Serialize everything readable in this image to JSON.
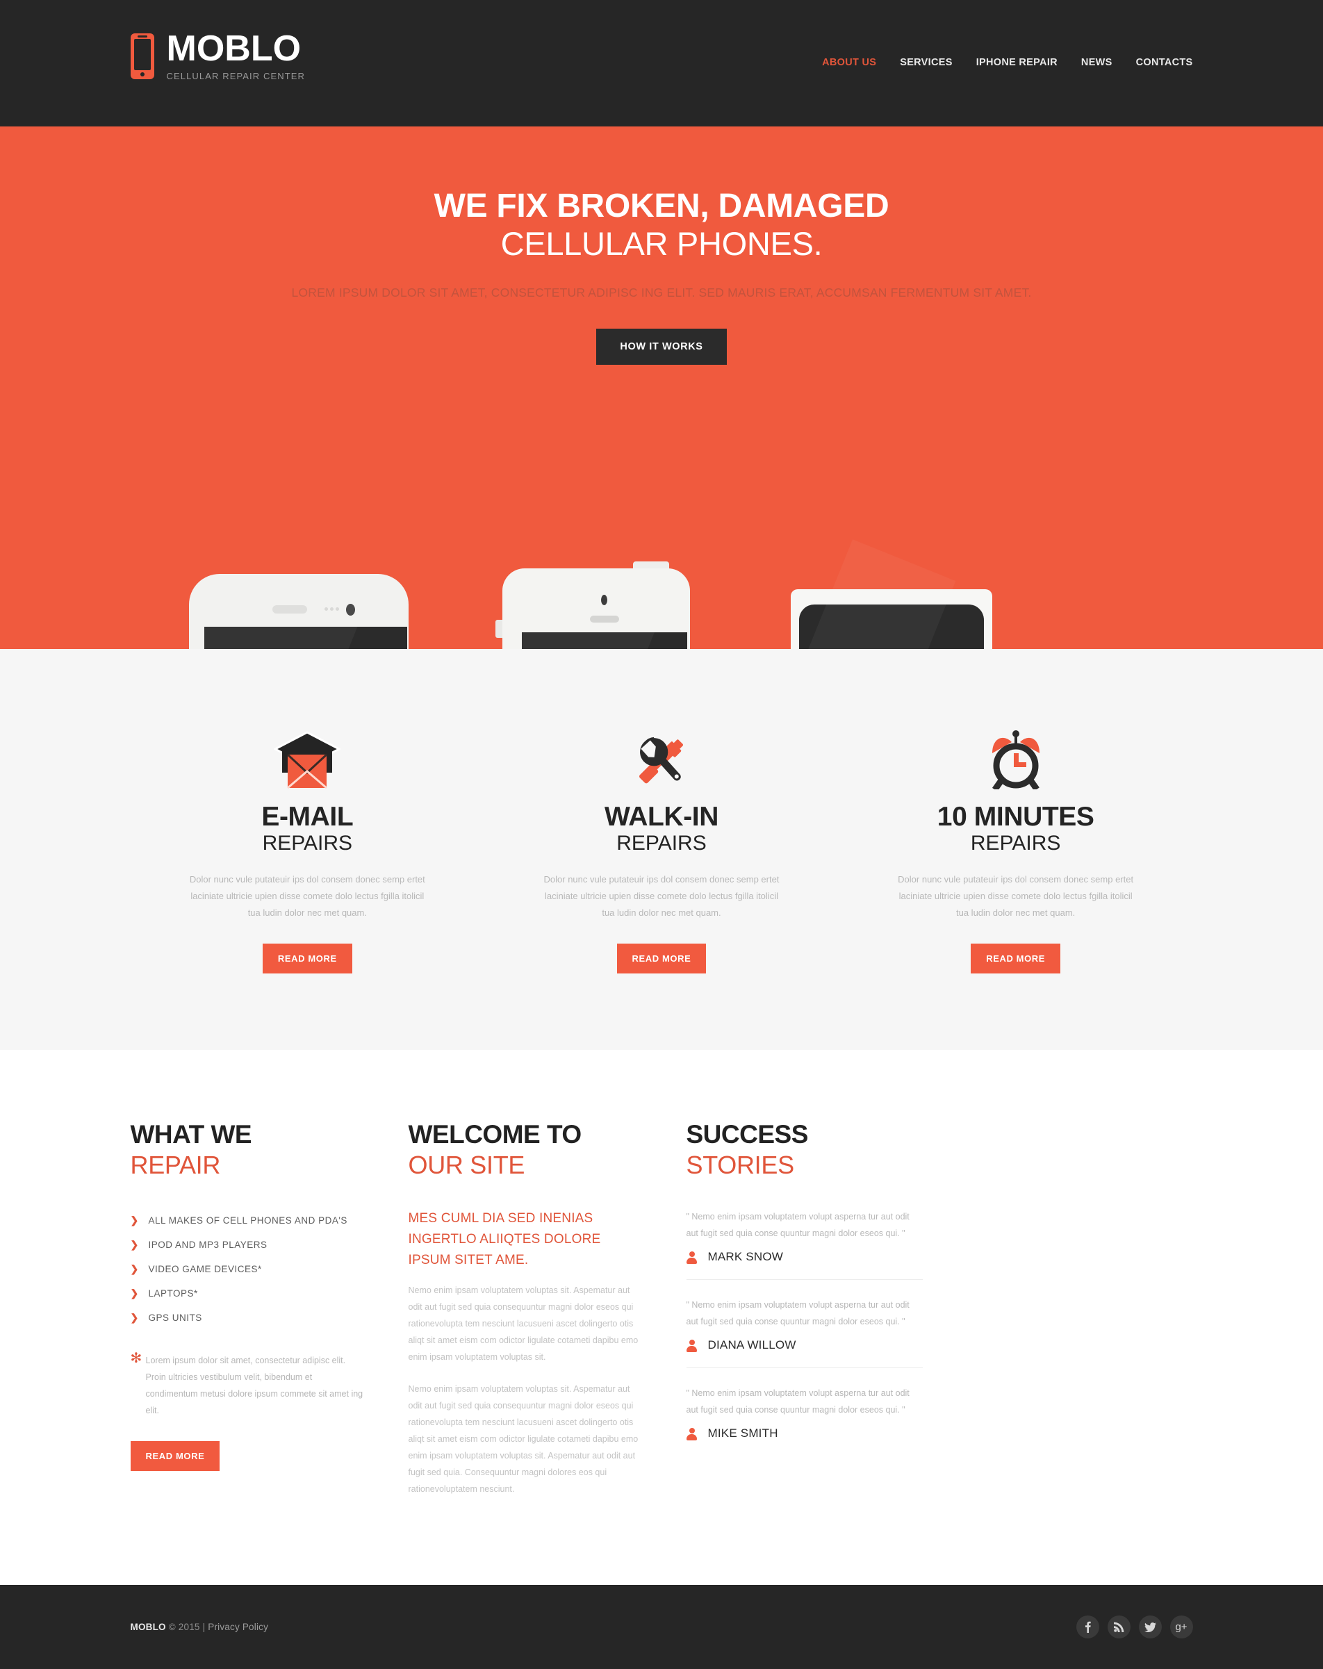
{
  "header": {
    "logo": {
      "title": "MOBLO",
      "subtitle": "CELLULAR REPAIR CENTER",
      "icon": "mobile-phone-icon"
    },
    "nav": [
      {
        "label": "ABOUT US",
        "active": true
      },
      {
        "label": "SERVICES",
        "active": false
      },
      {
        "label": "IPHONE REPAIR",
        "active": false
      },
      {
        "label": "NEWS",
        "active": false
      },
      {
        "label": "CONTACTS",
        "active": false
      }
    ]
  },
  "hero": {
    "title_line1": "WE FIX BROKEN, DAMAGED",
    "title_line2": "CELLULAR PHONES.",
    "subtitle": "LOREM IPSUM DOLOR SIT AMET, CONSECTETUR ADIPISC ING ELIT. SED MAURIS ERAT, ACCUMSAN FERMENTUM SIT AMET.",
    "button": "HOW IT WORKS",
    "devices": [
      "android-phone-illustration",
      "iphone-illustration",
      "tablet-illustration"
    ]
  },
  "services": [
    {
      "icon": "envelope-icon",
      "title": "E-MAIL",
      "subtitle": "REPAIRS",
      "text": "Dolor nunc vule putateuir ips dol consem donec semp ertet laciniate ultricie upien disse comete dolo lectus fgilla itolicil tua ludin dolor nec met quam.",
      "button": "READ MORE"
    },
    {
      "icon": "wrench-screwdriver-icon",
      "title": "WALK-IN",
      "subtitle": "REPAIRS",
      "text": "Dolor nunc vule putateuir ips dol consem donec semp ertet laciniate ultricie upien disse comete dolo lectus fgilla itolicil tua ludin dolor nec met quam.",
      "button": "READ MORE"
    },
    {
      "icon": "alarm-clock-icon",
      "title": "10 MINUTES",
      "subtitle": "REPAIRS",
      "text": "Dolor nunc vule putateuir ips dol consem donec semp ertet laciniate ultricie upien disse comete dolo lectus fgilla itolicil tua ludin dolor nec met quam.",
      "button": "READ MORE"
    }
  ],
  "what_we_repair": {
    "heading_dark": "WHAT WE",
    "heading_accent": "REPAIR",
    "items": [
      "ALL MAKES OF CELL PHONES AND PDA'S",
      "IPOD AND MP3 PLAYERS",
      "VIDEO GAME DEVICES*",
      "LAPTOPS*",
      "GPS UNITS"
    ],
    "note_symbol": "✻",
    "note": "Lorem ipsum dolor sit amet, consectetur adipisc elit. Proin ultricies vestibulum velit, bibendum et condimentum metusi dolore ipsum commete sit amet ing elit.",
    "button": "READ MORE"
  },
  "welcome": {
    "heading_dark": "WELCOME TO",
    "heading_accent": "OUR SITE",
    "sub_heading": "MES CUML DIA SED INENIAS INGERTLO ALIIQTES DOLORE IPSUM SITET AME.",
    "paragraph1": "Nemo enim ipsam voluptatem voluptas sit. Aspematur aut odit aut fugit sed quia consequuntur magni dolor eseos qui rationevolupta tem nesciunt lacusueni ascet dolingerto otis aliqt sit amet eism com odictor ligulate cotameti dapibu emo enim ipsam voluptatem voluptas sit.",
    "paragraph2": "Nemo enim ipsam voluptatem voluptas sit. Aspematur aut odit aut fugit sed quia consequuntur magni dolor eseos qui rationevolupta tem nesciunt lacusueni ascet dolingerto otis aliqt sit amet eism com odictor ligulate cotameti dapibu emo enim ipsam voluptatem voluptas sit. Aspematur aut odit aut fugit sed quia. Consequuntur magni dolores eos qui rationevoluptatem nesciunt."
  },
  "success": {
    "heading_dark": "SUCCESS",
    "heading_accent": "STORIES",
    "testimonials": [
      {
        "quote": "\" Nemo enim ipsam voluptatem volupt asperna tur aut odit aut fugit sed quia conse quuntur magni dolor eseos qui. \"",
        "name": "MARK SNOW",
        "icon": "person-icon"
      },
      {
        "quote": "\" Nemo enim ipsam voluptatem volupt asperna tur aut odit aut fugit sed quia conse quuntur magni dolor eseos qui. \"",
        "name": "DIANA WILLOW",
        "icon": "person-icon"
      },
      {
        "quote": "\" Nemo enim ipsam voluptatem volupt asperna tur aut odit aut fugit sed quia conse quuntur magni dolor eseos qui. \"",
        "name": "MIKE SMITH",
        "icon": "person-icon"
      }
    ]
  },
  "footer": {
    "brand": "MOBLO",
    "copyright": "© 2015 |",
    "privacy": "Privacy Policy",
    "socials": [
      {
        "name": "facebook-icon",
        "glyph": "f"
      },
      {
        "name": "rss-icon",
        "glyph": "rss"
      },
      {
        "name": "twitter-icon",
        "glyph": "t"
      },
      {
        "name": "google-plus-icon",
        "glyph": "g+"
      }
    ]
  },
  "colors": {
    "accent": "#f05a3e",
    "accent_text": "#e0553a",
    "dark": "#262626",
    "light_gray_section": "#f6f6f6"
  }
}
